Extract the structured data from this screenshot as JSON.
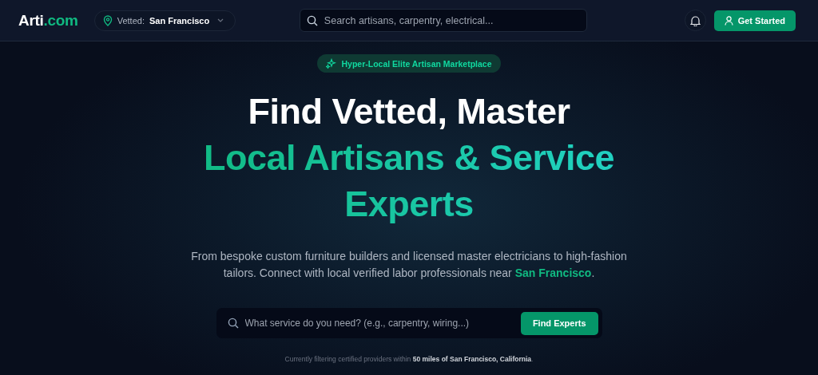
{
  "header": {
    "logo": {
      "name": "Arti",
      "suffix": ".com"
    },
    "location": {
      "label": "Vetted:",
      "city": "San Francisco"
    },
    "search": {
      "placeholder": "Search artisans, carpentry, electrical..."
    },
    "cta": "Get Started"
  },
  "hero": {
    "badge": "Hyper-Local Elite Artisan Marketplace",
    "title": "Find Vetted, Master",
    "accent": "Local Artisans & Service Experts",
    "description": "From bespoke custom furniture builders and licensed master electricians to high-fashion tailors. Connect with local verified labor professionals near **San Francisco**.",
    "search": {
      "placeholder": "What service do you need? (e.g., carpentry, wiring...)",
      "button": "Find Experts"
    },
    "note": "Currently filtering certified providers within **50 miles of San Francisco, California**."
  }
}
